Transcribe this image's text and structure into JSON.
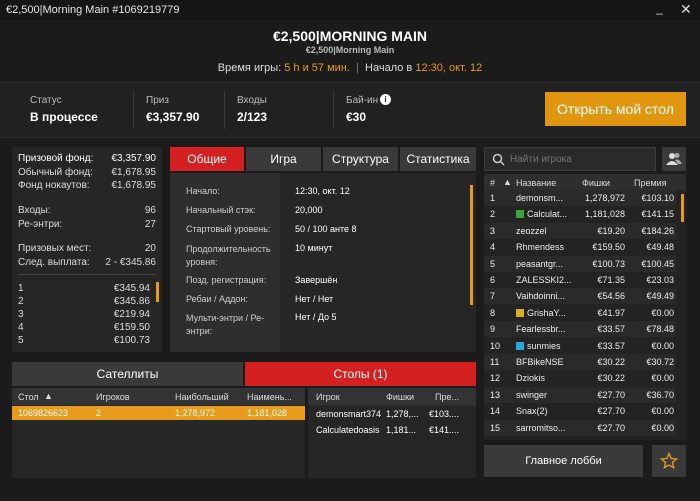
{
  "window": {
    "title": "€2,500|Morning Main #1069219779",
    "minimize": "_",
    "close": "✕"
  },
  "header": {
    "title": "€2,500|MORNING MAIN",
    "subtitle": "€2,500|Morning Main",
    "time_label": "Время игры:",
    "time_value": "5 h и 57 мин.",
    "start_label": "Начало в",
    "start_value": "12:30, окт. 12"
  },
  "info": {
    "status_label": "Статус",
    "status_value": "В процессе",
    "prize_label": "Приз",
    "prize_value": "€3,357.90",
    "entries_label": "Входы",
    "entries_value": "2/123",
    "buyin_label": "Бай-ин",
    "buyin_value": "€30",
    "open_table": "Открыть мой стол"
  },
  "stats": {
    "prize_pool_label": "Призовой фонд:",
    "prize_pool": "€3,357.90",
    "regular_label": "Обычный фонд:",
    "regular": "€1,678.95",
    "knockout_label": "Фонд нокаутов:",
    "knockout": "€1,678.95",
    "entries_label": "Входы:",
    "entries": "96",
    "reentries_label": "Ре-энтри:",
    "reentries": "27",
    "places_label": "Призовых мест:",
    "places": "20",
    "next_label": "След. выплата:",
    "next": "2 - €345.86",
    "payouts": [
      {
        "place": "1",
        "amount": "€345.94"
      },
      {
        "place": "2",
        "amount": "€345.86"
      },
      {
        "place": "3",
        "amount": "€219.94"
      },
      {
        "place": "4",
        "amount": "€159.50"
      },
      {
        "place": "5",
        "amount": "€100.73"
      }
    ]
  },
  "tabs": {
    "general": "Общие",
    "game": "Игра",
    "structure": "Структура",
    "statistics": "Статистика"
  },
  "details": [
    {
      "label": "Начало:",
      "value": "12:30, окт. 12"
    },
    {
      "label": "Начальный стэк:",
      "value": "20,000"
    },
    {
      "label": "Стартовый уровень:",
      "value": "50 / 100 анте 8"
    },
    {
      "label": "Продолжительность уровня:",
      "value": "10 минут"
    },
    {
      "label": "Позд. регистрация:",
      "value": "Завершён"
    },
    {
      "label": "Ребаи / Аддон:",
      "value": "Нет / Нет"
    },
    {
      "label": "Мульти-энтри / Ре-энтри:",
      "value": "Нет / До 5"
    }
  ],
  "bottom_tabs": {
    "satellites": "Сателлиты",
    "tables": "Столы (1)"
  },
  "tables_grid": {
    "headers": {
      "table": "Стол",
      "players": "Игроков",
      "largest": "Наибольший",
      "smallest": "Наимень..."
    },
    "rows": [
      {
        "table": "1069826623",
        "players": "2",
        "largest": "1,278,972",
        "smallest": "1,181,028"
      }
    ]
  },
  "table_players": {
    "headers": {
      "player": "Игрок",
      "chips": "Фишки",
      "prize": "Пре..."
    },
    "rows": [
      {
        "player": "demonsmart374",
        "chips": "1,278,...",
        "prize": "€103...."
      },
      {
        "player": "Calculatedoasis",
        "chips": "1,181...",
        "prize": "€141...."
      }
    ]
  },
  "search": {
    "placeholder": "Найти игрока"
  },
  "players_list": {
    "headers": {
      "rank": "#",
      "name": "Название",
      "chips": "Фишки",
      "prize": "Премия"
    },
    "rows": [
      {
        "rank": "1",
        "name": "demonsm...",
        "chips": "1,278,972",
        "prize": "€103.10",
        "badge": ""
      },
      {
        "rank": "2",
        "name": "Calculat...",
        "chips": "1,181,028",
        "prize": "€141.15",
        "badge": "#3aa635"
      },
      {
        "rank": "3",
        "name": "zeozzel",
        "chips": "€19.20",
        "prize": "€184.26",
        "badge": ""
      },
      {
        "rank": "4",
        "name": "Rhmendess",
        "chips": "€159.50",
        "prize": "€49.48",
        "badge": ""
      },
      {
        "rank": "5",
        "name": "peasantgr...",
        "chips": "€100.73",
        "prize": "€100.45",
        "badge": ""
      },
      {
        "rank": "6",
        "name": "ZALESSKI2...",
        "chips": "€71.35",
        "prize": "€23.03",
        "badge": ""
      },
      {
        "rank": "7",
        "name": "Vaihdoinni...",
        "chips": "€54.56",
        "prize": "€49.49",
        "badge": ""
      },
      {
        "rank": "8",
        "name": "GrishaY...",
        "chips": "€41.97",
        "prize": "€0.00",
        "badge": "#d4b01c"
      },
      {
        "rank": "9",
        "name": "Fearlessbr...",
        "chips": "€33.57",
        "prize": "€78.48",
        "badge": ""
      },
      {
        "rank": "10",
        "name": "sunmies",
        "chips": "€33.57",
        "prize": "€0.00",
        "badge": "#29a8e0"
      },
      {
        "rank": "11",
        "name": "BFBikeNSE",
        "chips": "€30.22",
        "prize": "€30.72",
        "badge": ""
      },
      {
        "rank": "12",
        "name": "Dziokis",
        "chips": "€30.22",
        "prize": "€0.00",
        "badge": ""
      },
      {
        "rank": "13",
        "name": "swinger",
        "chips": "€27.70",
        "prize": "€36.70",
        "badge": ""
      },
      {
        "rank": "14",
        "name": "Snax(2)",
        "chips": "€27.70",
        "prize": "€0.00",
        "badge": ""
      },
      {
        "rank": "15",
        "name": "sarromitso...",
        "chips": "€27.70",
        "prize": "€0.00",
        "badge": ""
      }
    ]
  },
  "lobby_button": "Главное лобби",
  "colors": {
    "accent": "#e0960f",
    "tab_active": "#d42020",
    "table_row_highlight": "#e89a1a"
  }
}
